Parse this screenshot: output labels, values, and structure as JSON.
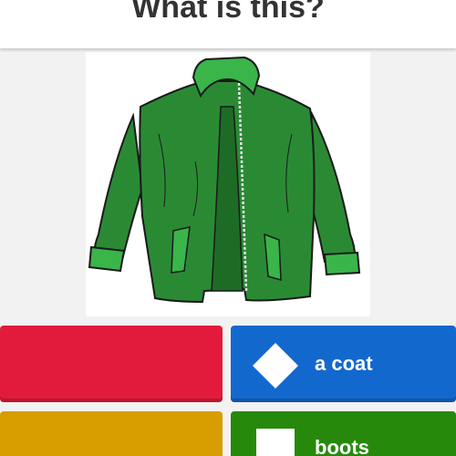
{
  "question": {
    "text": "What is this?"
  },
  "image": {
    "icon": "green-jacket-illustration",
    "colors": {
      "body": "#2a8a34",
      "trim": "#39b54a",
      "shadow": "#1e6b26",
      "outline": "#1a1a1a"
    }
  },
  "answers": [
    {
      "label": "",
      "color": "#e21b3c",
      "shape": "triangle"
    },
    {
      "label": "a coat",
      "color": "#1368ce",
      "shape": "diamond-icon"
    },
    {
      "label": "",
      "color": "#d89e00",
      "shape": "circle"
    },
    {
      "label": "boots",
      "color": "#26890c",
      "shape": "square-icon"
    }
  ]
}
